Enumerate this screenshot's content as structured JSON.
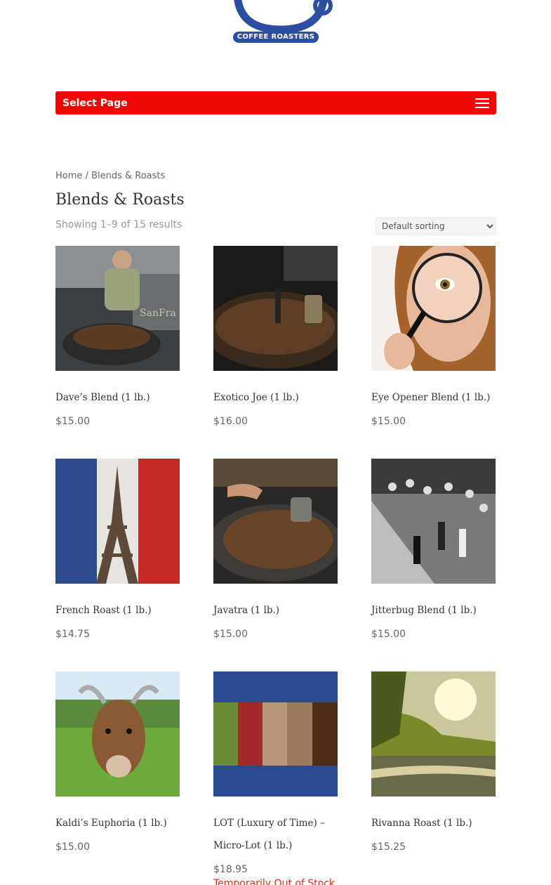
{
  "header": {
    "logo_text": "COFFEE ROASTERS",
    "brand_color": "#2c4ea3"
  },
  "menu": {
    "label": "Select Page",
    "bar_color": "#f20707"
  },
  "breadcrumb": {
    "home": "Home",
    "separator": "/",
    "current": "Blends & Roasts"
  },
  "page": {
    "title": "Blends & Roasts",
    "result_count": "Showing 1–9 of 15 results",
    "sorting_selected": "Default sorting"
  },
  "products": [
    {
      "name": "Dave’s Blend (1 lb.)",
      "price": "$15.00",
      "image": "roaster-man-photo"
    },
    {
      "name": "Exotico Joe (1 lb.)",
      "price": "$16.00",
      "image": "roasting-drum-photo"
    },
    {
      "name": "Eye Opener Blend (1 lb.)",
      "price": "$15.00",
      "image": "magnifying-glass-eye-photo"
    },
    {
      "name": "French Roast (1 lb.)",
      "price": "$14.75",
      "image": "eiffel-tower-flag-photo"
    },
    {
      "name": "Javatra (1 lb.)",
      "price": "$15.00",
      "image": "hand-in-roaster-photo"
    },
    {
      "name": "Jitterbug Blend (1 lb.)",
      "price": "$15.00",
      "image": "dancing-crowd-photo"
    },
    {
      "name": "Kaldi’s Euphoria (1 lb.)",
      "price": "$15.00",
      "image": "goat-photo"
    },
    {
      "name": "LOT (Luxury of Time) – Micro-Lot (1 lb.)",
      "price": "$18.95",
      "status": "Temporarily Out of Stock",
      "image": "coffee-bean-stages-photo"
    },
    {
      "name": "Rivanna Roast (1 lb.)",
      "price": "$15.25",
      "image": "river-sunlight-photo"
    }
  ],
  "colors": {
    "out_of_stock": "#e02b20"
  }
}
